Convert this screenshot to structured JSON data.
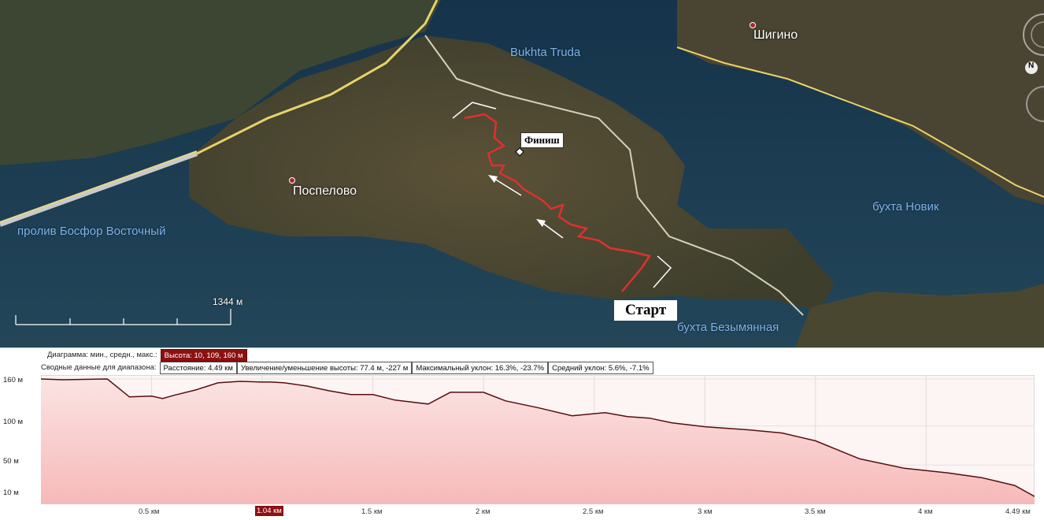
{
  "map": {
    "labels": {
      "bay_trud": "Bukhta Truda",
      "shigino": "Шигино",
      "poselovo": "Поспелово",
      "bosfor": "пролив Босфор Восточный",
      "novik": "бухта Новик",
      "bezymyannaya": "бухта Безымянная"
    },
    "finish_label": "Финиш",
    "start_label": "Старт",
    "scale_label": "1344 м",
    "nav_icon_label": "N",
    "colors": {
      "track": "#e03030",
      "road": "#e8d36a",
      "water": "#1d3a4c",
      "land": "#4f4a36"
    }
  },
  "profile": {
    "summary_header": "Диаграмма: мин., средн., макс.:",
    "height_stats": "Высота: 10, 109, 160 м",
    "range_header": "Сводные данные для диапазона:",
    "distance": "Расстояние: 4.49 км",
    "gain_loss": "Увеличение/уменьшение высоты: 77.4 м, -227 м",
    "max_slope": "Максимальный уклон: 16.3%, -23.7%",
    "avg_slope": "Средний уклон: 5.6%, -7.1%",
    "y_labels": [
      "160 м",
      "100 м",
      "50 м",
      "10 м"
    ],
    "x_labels": [
      "0.5 км",
      "1.04 км",
      "1.5 км",
      "2 км",
      "2.5 км",
      "3 км",
      "3.5 км",
      "4 км",
      "4.49 км"
    ],
    "selected_x": "1.04 км"
  },
  "chart_data": {
    "type": "area",
    "xlabel": "",
    "ylabel": "",
    "x": [
      0,
      0.1,
      0.3,
      0.4,
      0.5,
      0.55,
      0.6,
      0.7,
      0.8,
      0.9,
      1.0,
      1.04,
      1.1,
      1.2,
      1.3,
      1.4,
      1.5,
      1.6,
      1.75,
      1.85,
      2.0,
      2.1,
      2.25,
      2.4,
      2.55,
      2.65,
      2.75,
      2.85,
      3.0,
      3.2,
      3.35,
      3.5,
      3.7,
      3.9,
      4.1,
      4.25,
      4.4,
      4.49
    ],
    "y": [
      160,
      159,
      160,
      137,
      138,
      135,
      139,
      146,
      155,
      157,
      156,
      156,
      155,
      151,
      145,
      140,
      140,
      133,
      128,
      143,
      143,
      132,
      123,
      113,
      117,
      112,
      110,
      104,
      99,
      95,
      91,
      81,
      58,
      46,
      40,
      34,
      24,
      10
    ],
    "xlim": [
      0,
      4.49
    ],
    "ylim": [
      0,
      165
    ],
    "fill_color": "#f8c8c8",
    "line_color": "#5a0d0d",
    "grid": true
  }
}
